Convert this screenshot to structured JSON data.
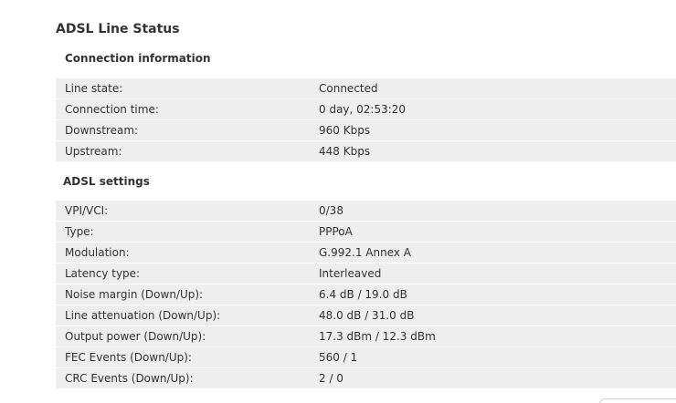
{
  "page": {
    "title": "ADSL Line Status"
  },
  "connection": {
    "title": "Connection information",
    "rows": [
      {
        "label": "Line state:",
        "value": "Connected"
      },
      {
        "label": "Connection time:",
        "value": "0 day, 02:53:20"
      },
      {
        "label": "Downstream:",
        "value": "960 Kbps"
      },
      {
        "label": "Upstream:",
        "value": "448 Kbps"
      }
    ]
  },
  "adsl": {
    "title": "ADSL settings",
    "rows": [
      {
        "label": "VPI/VCI:",
        "value": "0/38"
      },
      {
        "label": "Type:",
        "value": "PPPoA"
      },
      {
        "label": "Modulation:",
        "value": "G.992.1 Annex A"
      },
      {
        "label": "Latency type:",
        "value": "Interleaved"
      },
      {
        "label": "Noise margin (Down/Up):",
        "value": "6.4 dB / 19.0 dB"
      },
      {
        "label": "Line attenuation (Down/Up):",
        "value": "48.0 dB / 31.0 dB"
      },
      {
        "label": "Output power (Down/Up):",
        "value": "17.3 dBm / 12.3 dBm"
      },
      {
        "label": "FEC Events (Down/Up):",
        "value": "560 / 1"
      },
      {
        "label": "CRC Events (Down/Up):",
        "value": "2 / 0"
      }
    ]
  }
}
